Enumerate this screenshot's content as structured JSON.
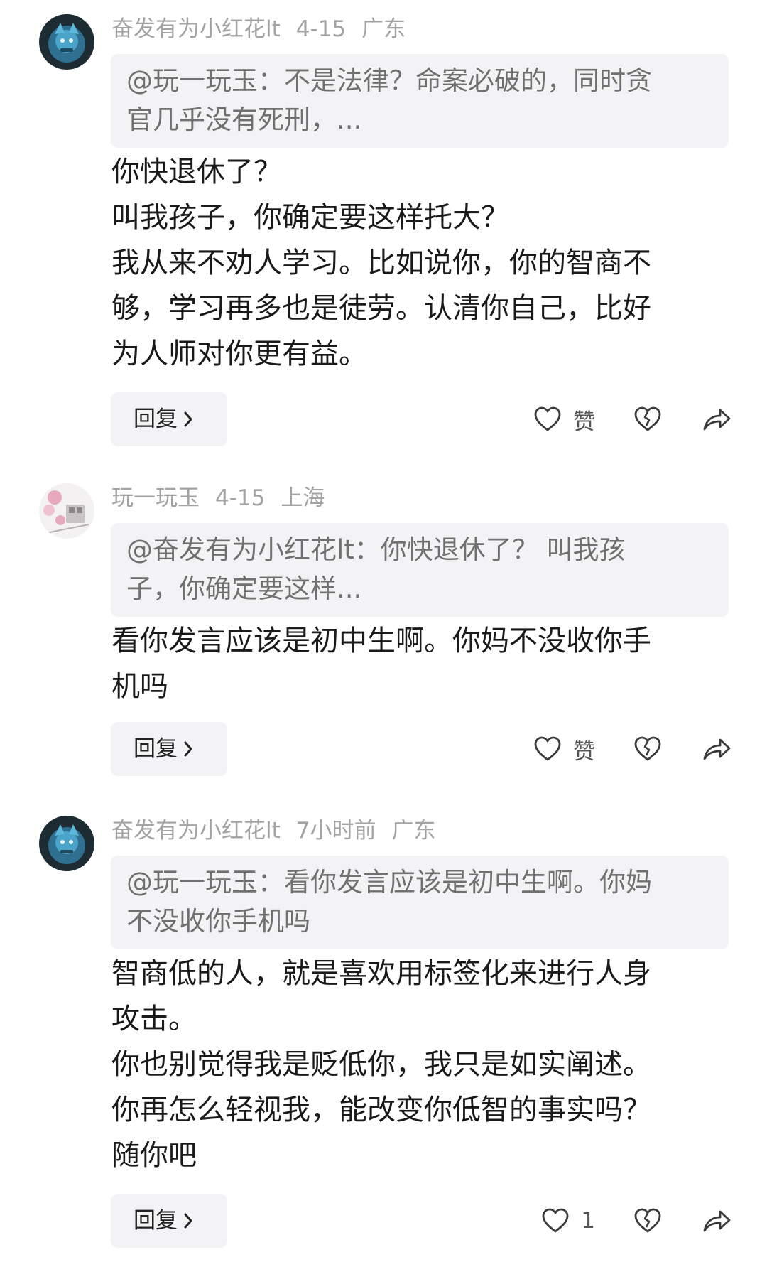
{
  "comments": [
    {
      "author": "奋发有为小红花lt",
      "date": "4-15",
      "location": "广东",
      "quote": [
        "@玩一玩玉：不是法律？命案必破的，同时贪",
        "官几乎没有死刑，..."
      ],
      "lines": [
        "你快退休了？",
        "叫我孩子，你确定要这样托大？",
        "我从来不劝人学习。比如说你，你的智商不",
        "够，学习再多也是徒劳。认清你自己，比好",
        "为人师对你更有益。"
      ],
      "reply_label": "回复",
      "like_label": "赞"
    },
    {
      "author": "玩一玩玉",
      "date": "4-15",
      "location": "上海",
      "quote": [
        "@奋发有为小红花lt：你快退休了？ 叫我孩",
        "子，你确定要这样..."
      ],
      "lines": [
        "看你发言应该是初中生啊。你妈不没收你手",
        "机吗"
      ],
      "reply_label": "回复",
      "like_label": "赞"
    },
    {
      "author": "奋发有为小红花lt",
      "date": "7小时前",
      "location": "广东",
      "quote": [
        "@玩一玩玉：看你发言应该是初中生啊。你妈",
        "不没收你手机吗"
      ],
      "lines": [
        "智商低的人，就是喜欢用标签化来进行人身",
        "攻击。",
        "你也别觉得我是贬低你，我只是如实阐述。",
        "你再怎么轻视我，能改变你低智的事实吗？",
        "随你吧"
      ],
      "reply_label": "回复",
      "like_label": "1"
    }
  ],
  "icons": {
    "like": "heart-outline-icon",
    "dislike": "broken-heart-icon",
    "share": "share-arrow-icon",
    "reply_chevron": "chevron-right-icon"
  },
  "colors": {
    "meta_text": "#a3a3a3",
    "quote_bg": "#f3f3f5",
    "quote_text": "#707070",
    "body_text": "#1a1a1a"
  }
}
